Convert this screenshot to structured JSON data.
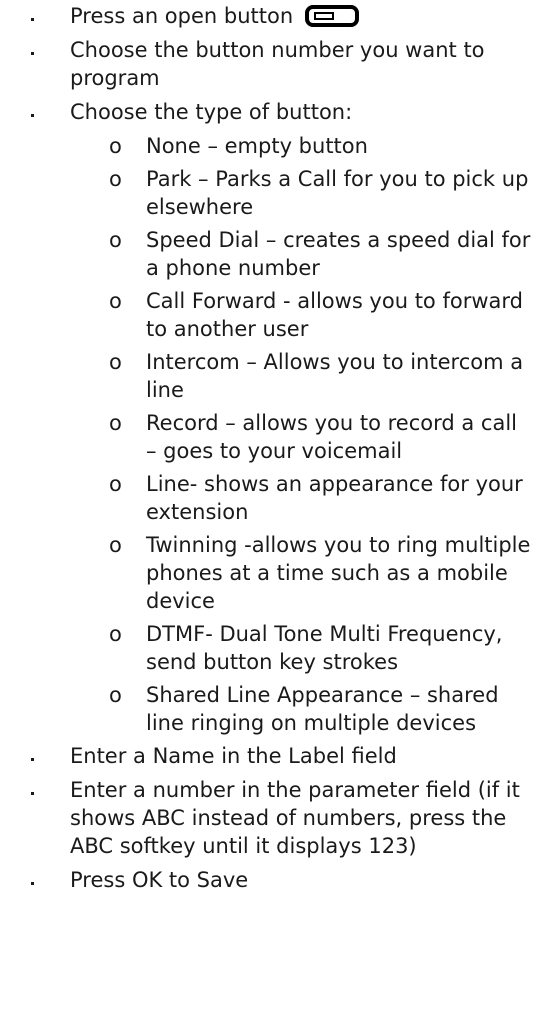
{
  "steps": [
    {
      "text": "Press an open button",
      "icon": "open-button-key-icon"
    },
    {
      "text": "Choose the button number you want to program"
    },
    {
      "text": "Choose the type of button:"
    },
    {
      "text": "Enter a Name in the Label field"
    },
    {
      "text": "Enter a number in the parameter field (if it shows ABC instead of numbers, press the ABC softkey until it displays 123)"
    },
    {
      "text": "Press OK to Save"
    }
  ],
  "sub_marker": "o",
  "button_types": [
    "None – empty button",
    "Park – Parks a Call for you to pick up elsewhere",
    "Speed Dial – creates a speed dial for a phone number",
    "Call Forward - allows you to forward to another user",
    "Intercom – Allows you to intercom a line",
    "Record – allows you to record a call – goes to your voicemail",
    "Line- shows an appearance for your extension",
    "Twinning -allows you to ring multiple phones at a time such as a mobile device",
    "DTMF- Dual Tone Multi Frequency, send button key strokes",
    "Shared Line Appearance – shared line ringing on multiple devices"
  ]
}
